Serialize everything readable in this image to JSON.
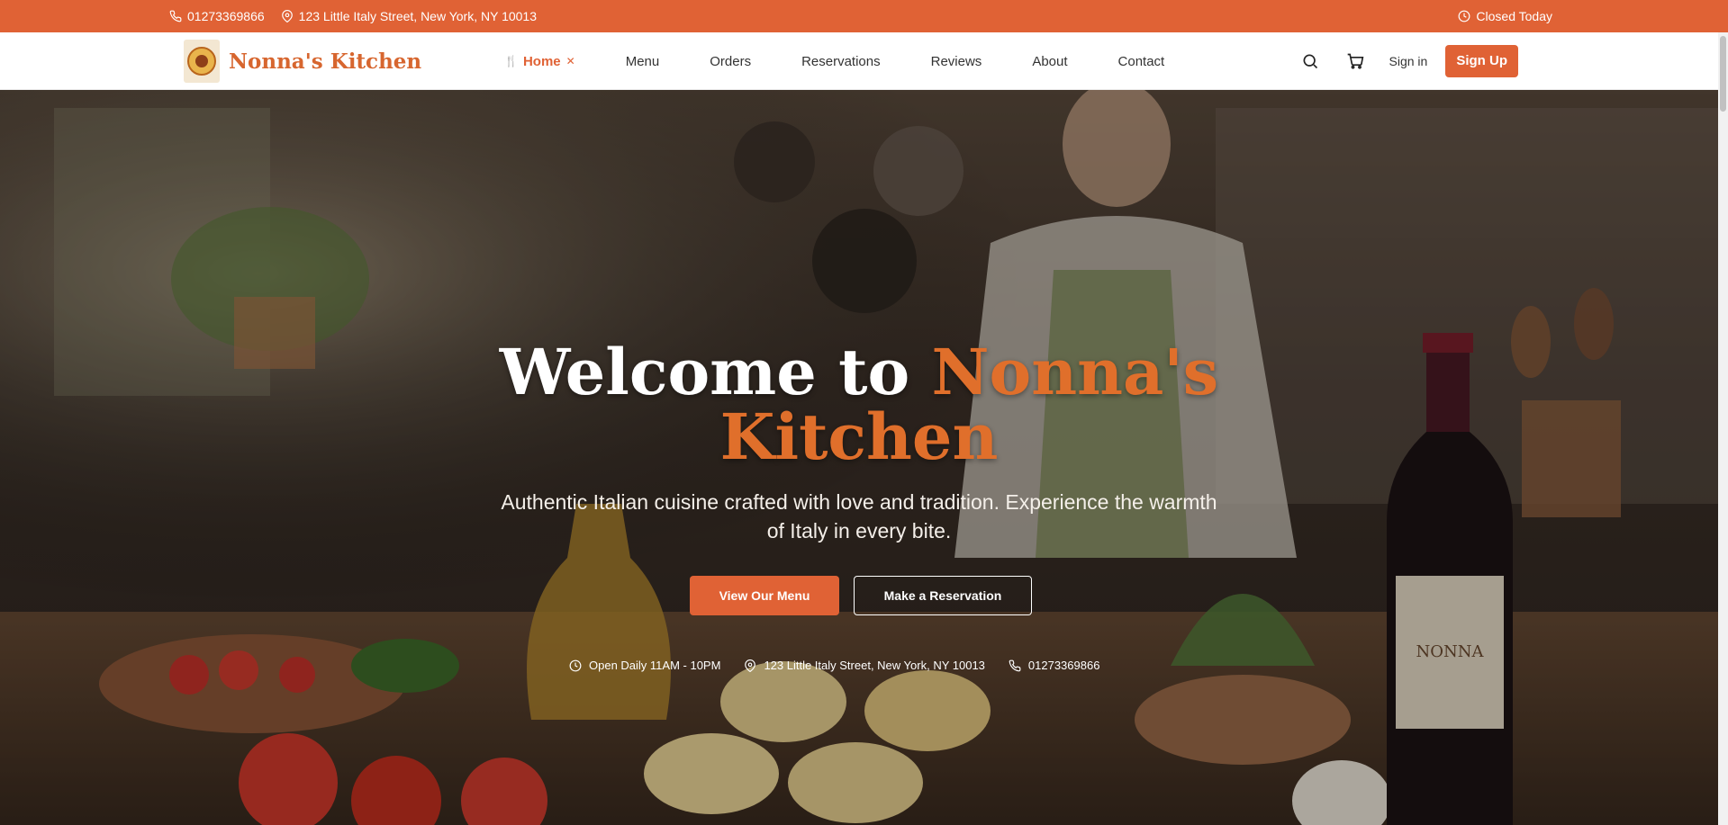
{
  "topbar": {
    "phone": "01273369866",
    "address": "123 Little Italy Street, New York, NY 10013",
    "status": "Closed Today"
  },
  "brand": {
    "name": "Nonna's Kitchen",
    "accent_color": "#e06235"
  },
  "nav": {
    "items": [
      {
        "label": "Home",
        "active": true
      },
      {
        "label": "Menu"
      },
      {
        "label": "Orders"
      },
      {
        "label": "Reservations"
      },
      {
        "label": "Reviews"
      },
      {
        "label": "About"
      },
      {
        "label": "Contact"
      }
    ],
    "signin": "Sign in",
    "signup": "Sign Up",
    "icons": [
      "search-icon",
      "cart-icon"
    ]
  },
  "hero": {
    "title_white": "Welcome to",
    "title_accent_1": "Nonna's",
    "title_accent_2": "Kitchen",
    "subtitle": "Authentic Italian cuisine crafted with love and tradition. Experience the warmth of Italy in every bite.",
    "btn_primary": "View Our Menu",
    "btn_secondary": "Make a Reservation",
    "info": {
      "hours": "Open Daily 11AM - 10PM",
      "address": "123 Little Italy Street, New York, NY 10013",
      "phone": "01273369866"
    }
  }
}
